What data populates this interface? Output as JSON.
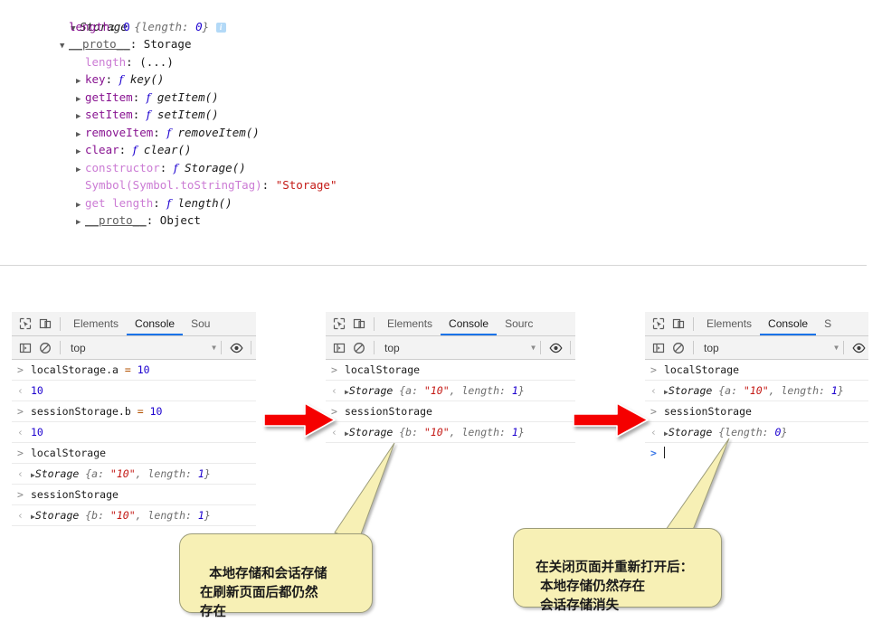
{
  "object_tree": {
    "header": {
      "triangle": "triangle-down",
      "type": "Storage",
      "summary": "{length: 0}",
      "info_badge": "i"
    },
    "rows": [
      {
        "indent": 1,
        "triangle": "",
        "key": "length",
        "sep": ":",
        "value": "0",
        "value_kind": "number"
      },
      {
        "indent": 1,
        "triangle": "triangle-down",
        "key": "__proto__",
        "sep": ":",
        "value": "Storage",
        "value_kind": "plain",
        "key_kind": "proto"
      },
      {
        "indent": 2,
        "triangle": "",
        "key": "length",
        "sep": ":",
        "value": "(...)",
        "value_kind": "plain",
        "key_kind": "faint"
      },
      {
        "indent": 2,
        "triangle": "triangle-right",
        "key": "key",
        "sep": ":",
        "value": "key()",
        "value_kind": "fn"
      },
      {
        "indent": 2,
        "triangle": "triangle-right",
        "key": "getItem",
        "sep": ":",
        "value": "getItem()",
        "value_kind": "fn"
      },
      {
        "indent": 2,
        "triangle": "triangle-right",
        "key": "setItem",
        "sep": ":",
        "value": "setItem()",
        "value_kind": "fn"
      },
      {
        "indent": 2,
        "triangle": "triangle-right",
        "key": "removeItem",
        "sep": ":",
        "value": "removeItem()",
        "value_kind": "fn"
      },
      {
        "indent": 2,
        "triangle": "triangle-right",
        "key": "clear",
        "sep": ":",
        "value": "clear()",
        "value_kind": "fn"
      },
      {
        "indent": 2,
        "triangle": "triangle-right",
        "key": "constructor",
        "sep": ":",
        "value": "Storage()",
        "value_kind": "fn",
        "key_kind": "faint"
      },
      {
        "indent": 2,
        "triangle": "",
        "key": "Symbol(Symbol.toStringTag)",
        "sep": ":",
        "value": "\"Storage\"",
        "value_kind": "string",
        "key_kind": "faint"
      },
      {
        "indent": 2,
        "triangle": "triangle-right",
        "key": "get length",
        "sep": ":",
        "value": "length()",
        "value_kind": "fn",
        "key_kind": "faint"
      },
      {
        "indent": 2,
        "triangle": "triangle-right",
        "key": "__proto__",
        "sep": ":",
        "value": "Object",
        "value_kind": "plain",
        "key_kind": "proto"
      }
    ]
  },
  "panels": [
    {
      "id": "panel-1",
      "tabs": [
        {
          "label": "Elements",
          "active": false
        },
        {
          "label": "Console",
          "active": true
        },
        {
          "label": "Sou",
          "active": false
        }
      ],
      "toolbar": {
        "context": "top",
        "dropdown_icon": "chevron-down-icon",
        "eye_icon": "eye-icon",
        "sidebar_icon": "show-console-sidebar-icon",
        "clear_icon": "clear-console-icon",
        "inspect_icon": "inspect-element-icon",
        "device_icon": "toggle-device-toolbar-icon"
      },
      "lines": [
        {
          "kind": "input",
          "segments": [
            {
              "t": "localStorage.a ",
              "c": "ident"
            },
            {
              "t": "= ",
              "c": "op"
            },
            {
              "t": "10",
              "c": "number"
            }
          ]
        },
        {
          "kind": "output",
          "segments": [
            {
              "t": "10",
              "c": "number"
            }
          ]
        },
        {
          "kind": "input",
          "segments": [
            {
              "t": "sessionStorage.b ",
              "c": "ident"
            },
            {
              "t": "= ",
              "c": "op"
            },
            {
              "t": "10",
              "c": "number"
            }
          ]
        },
        {
          "kind": "output",
          "segments": [
            {
              "t": "10",
              "c": "number"
            }
          ]
        },
        {
          "kind": "input",
          "segments": [
            {
              "t": "localStorage",
              "c": "ident"
            }
          ]
        },
        {
          "kind": "output",
          "expandable": true,
          "segments": [
            {
              "t": "Storage ",
              "c": "objtype"
            },
            {
              "t": "{a: ",
              "c": "objkey"
            },
            {
              "t": "\"10\"",
              "c": "string"
            },
            {
              "t": ", length: ",
              "c": "objkey"
            },
            {
              "t": "1",
              "c": "number-i"
            },
            {
              "t": "}",
              "c": "objkey"
            }
          ]
        },
        {
          "kind": "input",
          "segments": [
            {
              "t": "sessionStorage",
              "c": "ident"
            }
          ]
        },
        {
          "kind": "output",
          "expandable": true,
          "segments": [
            {
              "t": "Storage ",
              "c": "objtype"
            },
            {
              "t": "{b: ",
              "c": "objkey"
            },
            {
              "t": "\"10\"",
              "c": "string"
            },
            {
              "t": ", length: ",
              "c": "objkey"
            },
            {
              "t": "1",
              "c": "number-i"
            },
            {
              "t": "}",
              "c": "objkey"
            }
          ]
        }
      ]
    },
    {
      "id": "panel-2",
      "tabs": [
        {
          "label": "Elements",
          "active": false
        },
        {
          "label": "Console",
          "active": true
        },
        {
          "label": "Sourc",
          "active": false
        }
      ],
      "toolbar": {
        "context": "top",
        "dropdown_icon": "chevron-down-icon",
        "eye_icon": "eye-icon",
        "sidebar_icon": "show-console-sidebar-icon",
        "clear_icon": "clear-console-icon",
        "inspect_icon": "inspect-element-icon",
        "device_icon": "toggle-device-toolbar-icon"
      },
      "lines": [
        {
          "kind": "input",
          "segments": [
            {
              "t": "localStorage",
              "c": "ident"
            }
          ]
        },
        {
          "kind": "output",
          "expandable": true,
          "segments": [
            {
              "t": "Storage ",
              "c": "objtype"
            },
            {
              "t": "{a: ",
              "c": "objkey"
            },
            {
              "t": "\"10\"",
              "c": "string"
            },
            {
              "t": ", length: ",
              "c": "objkey"
            },
            {
              "t": "1",
              "c": "number-i"
            },
            {
              "t": "}",
              "c": "objkey"
            }
          ]
        },
        {
          "kind": "input",
          "segments": [
            {
              "t": "sessionStorage",
              "c": "ident"
            }
          ]
        },
        {
          "kind": "output",
          "expandable": true,
          "segments": [
            {
              "t": "Storage ",
              "c": "objtype"
            },
            {
              "t": "{b: ",
              "c": "objkey"
            },
            {
              "t": "\"10\"",
              "c": "string"
            },
            {
              "t": ", length: ",
              "c": "objkey"
            },
            {
              "t": "1",
              "c": "number-i"
            },
            {
              "t": "}",
              "c": "objkey"
            }
          ]
        }
      ]
    },
    {
      "id": "panel-3",
      "tabs": [
        {
          "label": "Elements",
          "active": false
        },
        {
          "label": "Console",
          "active": true
        },
        {
          "label": "S",
          "active": false
        }
      ],
      "toolbar": {
        "context": "top",
        "dropdown_icon": "chevron-down-icon",
        "eye_icon": "eye-icon",
        "sidebar_icon": "show-console-sidebar-icon",
        "clear_icon": "clear-console-icon",
        "inspect_icon": "inspect-element-icon",
        "device_icon": "toggle-device-toolbar-icon"
      },
      "lines": [
        {
          "kind": "input",
          "segments": [
            {
              "t": "localStorage",
              "c": "ident"
            }
          ]
        },
        {
          "kind": "output",
          "expandable": true,
          "segments": [
            {
              "t": "Storage ",
              "c": "objtype"
            },
            {
              "t": "{a: ",
              "c": "objkey"
            },
            {
              "t": "\"10\"",
              "c": "string"
            },
            {
              "t": ", length: ",
              "c": "objkey"
            },
            {
              "t": "1",
              "c": "number-i"
            },
            {
              "t": "}",
              "c": "objkey"
            }
          ]
        },
        {
          "kind": "input",
          "segments": [
            {
              "t": "sessionStorage",
              "c": "ident"
            }
          ]
        },
        {
          "kind": "output",
          "expandable": true,
          "segments": [
            {
              "t": "Storage ",
              "c": "objtype"
            },
            {
              "t": "{length: ",
              "c": "objkey"
            },
            {
              "t": "0",
              "c": "number-i"
            },
            {
              "t": "}",
              "c": "objkey"
            }
          ]
        },
        {
          "kind": "prompt",
          "segments": []
        }
      ]
    }
  ],
  "arrows": [
    {
      "id": "arrow-1",
      "name": "red-arrow-right",
      "color": "#f00000"
    },
    {
      "id": "arrow-2",
      "name": "red-arrow-right",
      "color": "#f00000"
    }
  ],
  "callouts": [
    {
      "id": "callout-1",
      "text": "本地存储和会话存储\n在刷新页面后都仍然\n存在",
      "fill": "#f7f0b5",
      "border": "#9c9c7a"
    },
    {
      "id": "callout-2",
      "text": "在关闭页面并重新打开后：\n   本地存储仍然存在\n   会话存储消失",
      "fill": "#f7f0b5",
      "border": "#9c9c7a"
    }
  ]
}
